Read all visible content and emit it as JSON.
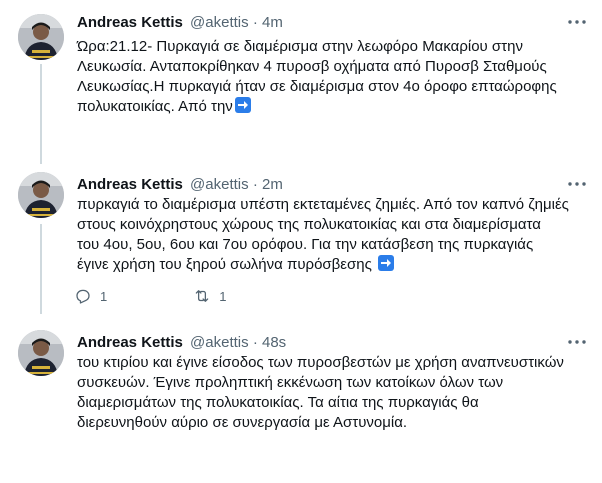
{
  "tweets": [
    {
      "author": {
        "name": "Andreas Kettis",
        "handle": "@akettis"
      },
      "separator": "·",
      "time": "4m",
      "lines": [
        "Ώρα:21.12- Πυρκαγιά σε διαμέρισμα στην λεωφόρο Μακαρίου  στην",
        "Λευκωσία. Ανταποκρίθηκαν 4 πυροσβ οχήματα από Πυροσβ Σταθμούς",
        "Λευκωσίας.Η πυρκαγιά ήταν σε διαμέρισμα στον 4ο όροφο επταώροφης",
        "πολυκατοικίας. Από την"
      ],
      "has_arrow": true,
      "reply_count": "",
      "retweet_count": ""
    },
    {
      "author": {
        "name": "Andreas Kettis",
        "handle": "@akettis"
      },
      "separator": "·",
      "time": "2m",
      "lines": [
        "πυρκαγιά το διαμέρισμα υπέστη εκτεταμένες ζημιές. Από τον καπνό ζημιές",
        "στους κοινόχρηστους χώρους της πολυκατοικίας και στα διαμερίσματα",
        "του 4ου, 5ου, 6ου και 7ου ορόφου. Για την κατάσβεση της πυρκαγιάς",
        "έγινε χρήση του ξηρού σωλήνα πυρόσβεσης"
      ],
      "has_arrow": true,
      "reply_count": "1",
      "retweet_count": "1"
    },
    {
      "author": {
        "name": "Andreas Kettis",
        "handle": "@akettis"
      },
      "separator": "·",
      "time": "48s",
      "lines": [
        "του κτιρίου και έγινε είσοδος των πυροσβεστών με χρήση αναπνευστικών",
        "συσκευών. Έγινε προληπτική εκκένωση των κατοίκων όλων των",
        "διαμερισμάτων της πολυκατοικίας. Τα αίτια της πυρκαγιάς θα",
        "διερευνηθούν αύριο σε συνεργασία με Αστυνομία."
      ],
      "has_arrow": false,
      "reply_count": "",
      "retweet_count": ""
    }
  ],
  "icons": {
    "more": "more-options-icon",
    "reply": "reply-icon",
    "retweet": "retweet-icon",
    "arrow": "right-arrow-emoji-icon",
    "avatar": "profile-avatar"
  },
  "colors": {
    "text": "#0f1419",
    "secondary": "#536471",
    "thread_line": "#cfd9de",
    "arrow_emoji": "#2b7de9"
  }
}
